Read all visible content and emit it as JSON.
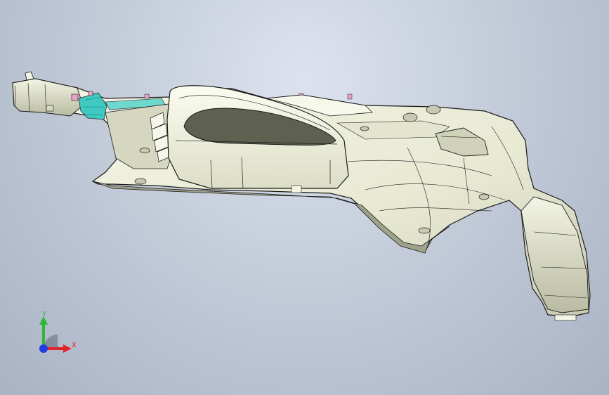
{
  "viewport": {
    "background_top": "#dde3ee",
    "background_bottom": "#a9b3c4"
  },
  "model": {
    "body_color": "#ecedd9",
    "edge_color": "#1a1a1a",
    "shadow_color": "#8f927c",
    "clip_teal_color": "#3fc9c0",
    "clip_pink_color": "#e7a3c8"
  },
  "triad": {
    "y_label": "Y",
    "x_label": "X",
    "y_color": "#2fb73a",
    "x_color": "#e0262a",
    "z_color": "#1f3fe0"
  }
}
